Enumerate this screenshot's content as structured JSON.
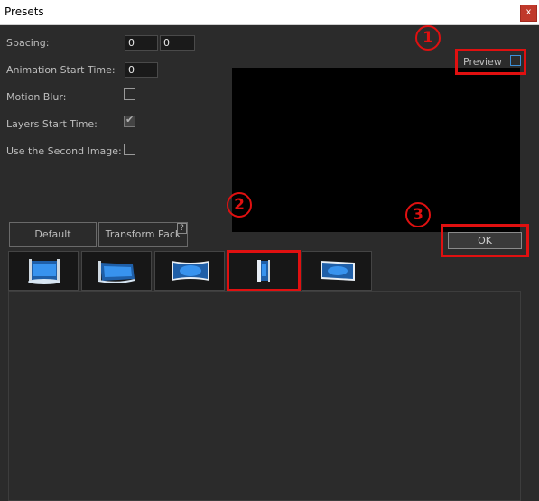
{
  "window": {
    "title": "Presets",
    "close_glyph": "x"
  },
  "fields": {
    "spacing_label": "Spacing:",
    "spacing_x": "0",
    "spacing_y": "0",
    "anim_start_label": "Animation Start Time:",
    "anim_start_value": "0",
    "motion_blur_label": "Motion Blur:",
    "motion_blur_checked": false,
    "layers_start_label": "Layers Start Time:",
    "layers_start_checked": true,
    "second_image_label": "Use the Second Image:",
    "second_image_checked": false
  },
  "preview": {
    "label": "Preview",
    "checked": false
  },
  "tabs": {
    "default_label": "Default",
    "transform_pack_label": "Transform Pack",
    "help_glyph": "?"
  },
  "ok_label": "OK",
  "markers": {
    "m1": "1",
    "m2": "2",
    "m3": "3"
  },
  "presets": [
    {
      "name": "scroll-flat"
    },
    {
      "name": "scroll-curl"
    },
    {
      "name": "wave-panel"
    },
    {
      "name": "edge-rotate"
    },
    {
      "name": "bent-panel"
    }
  ],
  "colors": {
    "highlight": "#e01010",
    "accent": "#3d8fd8",
    "background": "#2b2b2b"
  }
}
